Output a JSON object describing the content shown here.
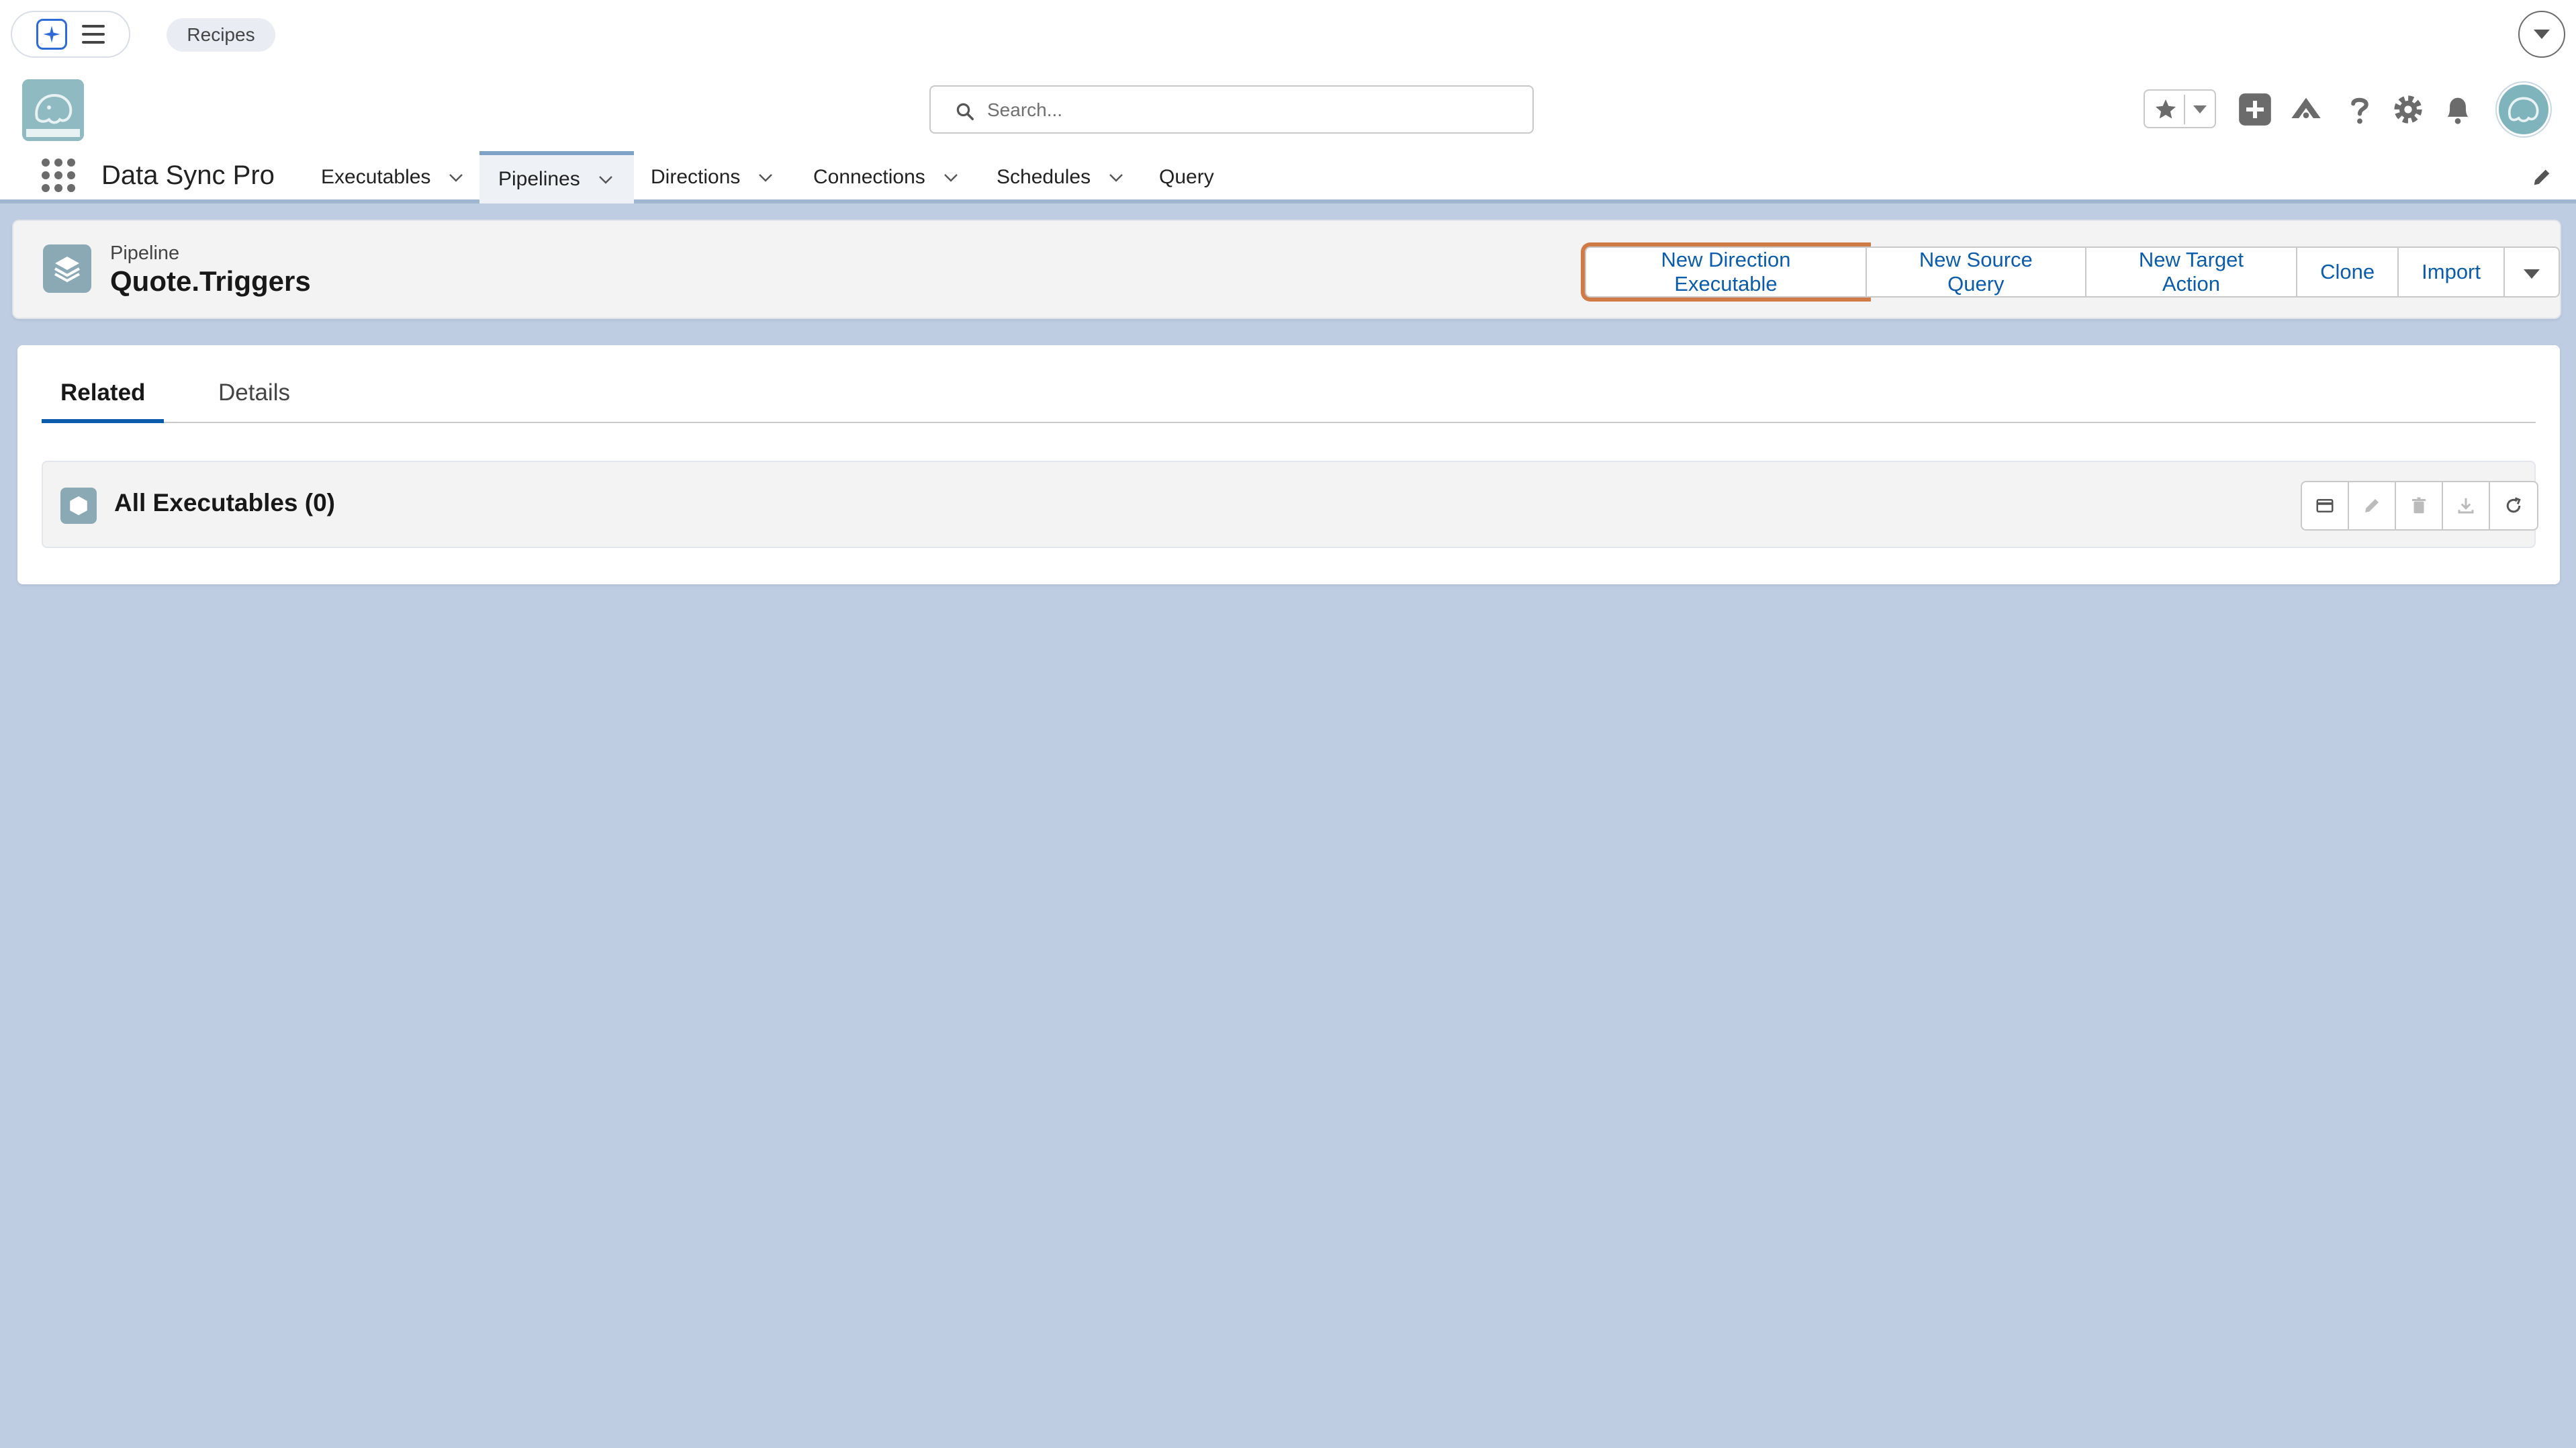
{
  "utility_bar": {
    "recipes_label": "Recipes"
  },
  "header": {
    "logo_text": "Data Sync Pro",
    "search_placeholder": "Search..."
  },
  "nav": {
    "app_name": "Data Sync Pro",
    "items": [
      {
        "label": "Executables",
        "has_menu": true
      },
      {
        "label": "Pipelines",
        "has_menu": true,
        "active": true
      },
      {
        "label": "Directions",
        "has_menu": true
      },
      {
        "label": "Connections",
        "has_menu": true
      },
      {
        "label": "Schedules",
        "has_menu": true
      },
      {
        "label": "Query",
        "has_menu": false
      }
    ]
  },
  "record": {
    "type": "Pipeline",
    "title": "Quote.Triggers",
    "actions": [
      "New Direction Executable",
      "New Source Query",
      "New Target Action",
      "Clone",
      "Import"
    ]
  },
  "tabs": [
    {
      "label": "Related",
      "active": true
    },
    {
      "label": "Details",
      "active": false
    }
  ],
  "related_list": {
    "title": "All Executables (0)"
  },
  "colors": {
    "page_bg": "#bfcde3",
    "brand_blue": "#0b5cab",
    "focus_ring": "#d07a46",
    "icon_teal": "#8aa9b5"
  }
}
